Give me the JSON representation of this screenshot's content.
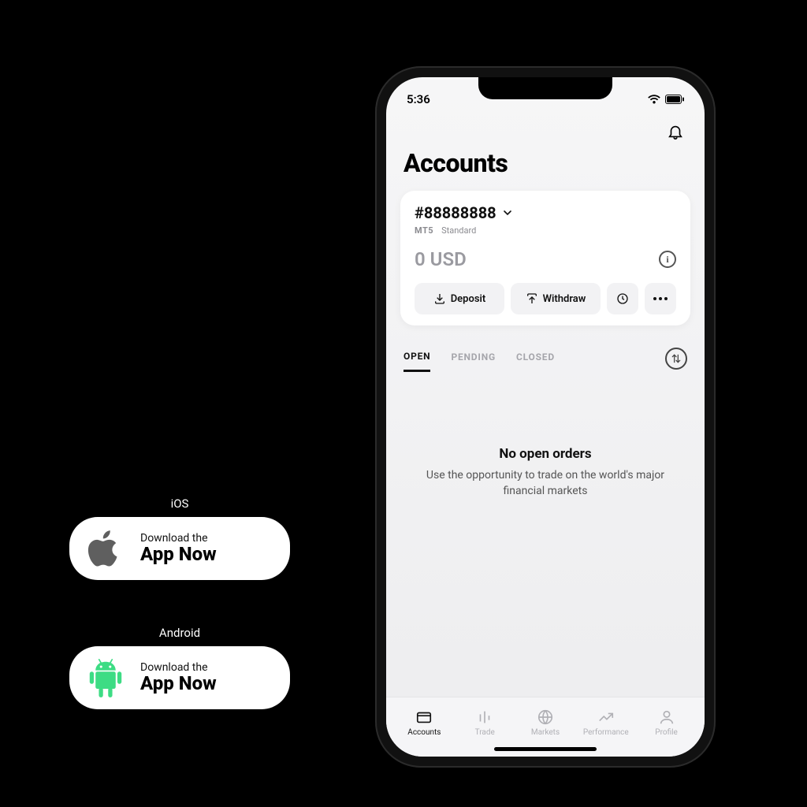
{
  "status": {
    "time": "5:36"
  },
  "page_title": "Accounts",
  "account": {
    "number": "#88888888",
    "platform": "MT5",
    "type": "Standard",
    "balance": "0 USD"
  },
  "actions": {
    "deposit": "Deposit",
    "withdraw": "Withdraw"
  },
  "tabs": {
    "open": "OPEN",
    "pending": "PENDING",
    "closed": "CLOSED"
  },
  "empty_state": {
    "title": "No open orders",
    "subtitle": "Use the opportunity to trade on the world's major financial markets"
  },
  "nav": {
    "accounts": "Accounts",
    "trade": "Trade",
    "markets": "Markets",
    "performance": "Performance",
    "profile": "Profile"
  },
  "downloads": {
    "ios_label": "iOS",
    "android_label": "Android",
    "line1": "Download the",
    "line2": "App Now"
  }
}
